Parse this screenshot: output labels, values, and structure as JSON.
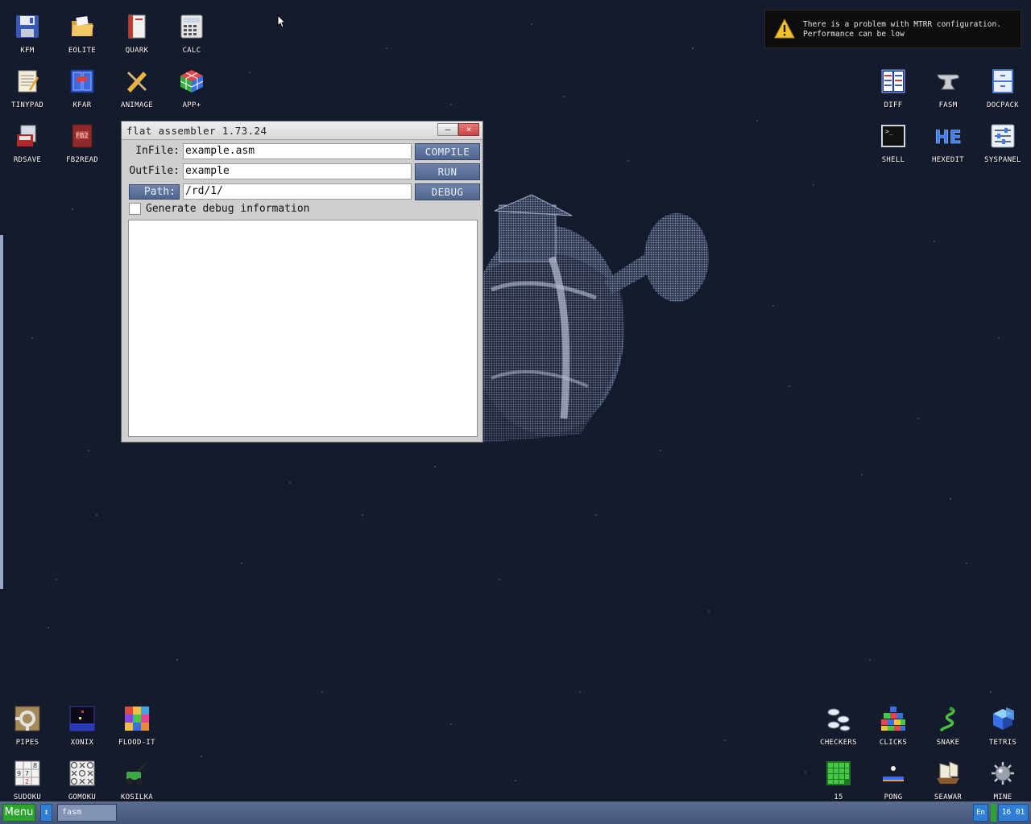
{
  "notification": {
    "line1": "There is a problem with MTRR configuration.",
    "line2": "Performance can be low"
  },
  "desktop_icons": {
    "kfm": "KFM",
    "eolite": "EOLITE",
    "quark": "QUARK",
    "calc": "CALC",
    "tinypad": "TINYPAD",
    "kfar": "KFAR",
    "animage": "ANIMAGE",
    "app_plus": "APP+",
    "rdsave": "RDSAVE",
    "fb2read": "FB2READ",
    "diff": "DIFF",
    "fasm": "FASM",
    "docpack": "DOCPACK",
    "shell": "SHELL",
    "hexedit": "HEXEDIT",
    "syspanel": "SYSPANEL",
    "pipes": "PIPES",
    "xonix": "XONIX",
    "flood_it": "FLOOD-IT",
    "sudoku": "SUDOKU",
    "gomoku": "GOMOKU",
    "kosilka": "KOSILKA",
    "checkers": "CHECKERS",
    "clicks": "CLICKS",
    "snake": "SNAKE",
    "tetris": "TETRIS",
    "fifteen": "15",
    "pong": "PONG",
    "seawar": "SEAWAR",
    "mine": "MINE"
  },
  "window": {
    "title": "flat assembler 1.73.24",
    "minimize_glyph": "–",
    "close_glyph": "×",
    "infile_label": "InFile:",
    "infile_value": "example.asm",
    "outfile_label": "OutFile:",
    "outfile_value": "example",
    "path_label": "Path:",
    "path_value": "/rd/1/",
    "compile_label": "COMPILE",
    "run_label": "RUN",
    "debug_label": "DEBUG",
    "debug_checkbox_label": "Generate debug information",
    "debug_checked": false
  },
  "taskbar": {
    "menu_label": "Menu",
    "switch_glyph": "↕",
    "task_label": "fasm",
    "language": "En",
    "clock": "16 01"
  },
  "colors": {
    "desktop": "#141b2d",
    "button": "#5a6f98",
    "menu_green": "#2fa330",
    "tray_blue": "#2f7fd6"
  }
}
